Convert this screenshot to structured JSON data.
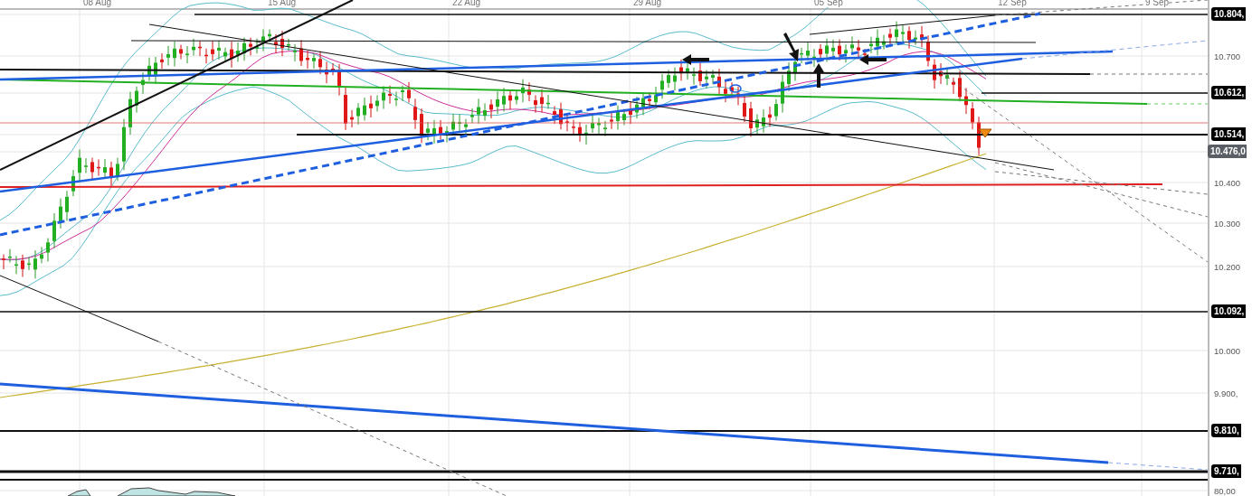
{
  "date_axis": [
    {
      "label": "08 Aug"
    },
    {
      "label": "15 Aug"
    },
    {
      "label": "22 Aug"
    },
    {
      "label": "29 Aug"
    },
    {
      "label": "05 Sep"
    },
    {
      "label": "12 Sep"
    },
    {
      "label": "9 Sep"
    }
  ],
  "price_axis": [
    {
      "label": "10.804,",
      "kind": "level"
    },
    {
      "label": "10.700",
      "kind": "tick"
    },
    {
      "label": "10.612,",
      "kind": "level"
    },
    {
      "label": "10.514,",
      "kind": "level"
    },
    {
      "label": "10.476,0",
      "kind": "current"
    },
    {
      "label": "10.400",
      "kind": "tick"
    },
    {
      "label": "10.300",
      "kind": "tick"
    },
    {
      "label": "10.200",
      "kind": "tick"
    },
    {
      "label": "10.092,",
      "kind": "level"
    },
    {
      "label": "10.000",
      "kind": "tick"
    },
    {
      "label": "9.900,",
      "kind": "tick"
    },
    {
      "label": "9.810,",
      "kind": "level"
    },
    {
      "label": "9.710,",
      "kind": "level"
    },
    {
      "label": "80,00",
      "kind": "tick"
    }
  ]
}
